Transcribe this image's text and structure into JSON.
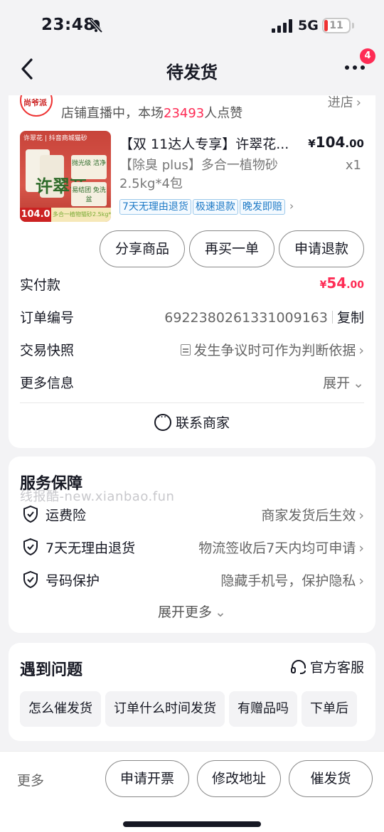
{
  "status_bar": {
    "time": "23:48",
    "network": "5G",
    "battery": "11"
  },
  "nav": {
    "title": "待发货",
    "badge": "4"
  },
  "shop": {
    "live_text": "店铺直播中，本场",
    "likes": "23493",
    "likes_suffix": "人点赞",
    "enter": "进店",
    "logo_text": "尚爷派"
  },
  "product": {
    "title": "【双 11达人专享】许翠花...",
    "price_symbol": "¥",
    "price_int": "104",
    "price_dec": ".00",
    "spec": "【除臭 plus】多合一植物砂 2.5kg*4包",
    "qty": "x1",
    "tags": [
      "7天无理由退货",
      "极速退款",
      "晚发即赔"
    ],
    "image": {
      "brand": "许翠花 | 抖音商城猫砂",
      "big_text": "许翠花",
      "tag1": "抛光级 洁净",
      "tag2": "易结团 免洗盆",
      "price_badge": "104.0",
      "strip": "多合一植物猫砂2.5kg*4"
    }
  },
  "actions": [
    "分享商品",
    "再买一单",
    "申请退款"
  ],
  "order": {
    "paid_label": "实付款",
    "paid_symbol": "¥",
    "paid_int": "54",
    "paid_dec": ".00",
    "number_label": "订单编号",
    "number": "6922380261331009163",
    "copy": "复制",
    "snapshot_label": "交易快照",
    "snapshot_value": "发生争议时可作为判断依据",
    "more_label": "更多信息",
    "more_value": "展开"
  },
  "contact": "联系商家",
  "service": {
    "title": "服务保障",
    "watermark": "线报酷-new.xianbao.fun",
    "items": [
      {
        "name": "运费险",
        "desc": "商家发货后生效"
      },
      {
        "name": "7天无理由退货",
        "desc": "物流签收后7天内均可申请"
      },
      {
        "name": "号码保护",
        "desc": "隐藏手机号，保护隐私"
      }
    ],
    "expand": "展开更多"
  },
  "problems": {
    "title": "遇到问题",
    "official": "官方客服",
    "chips": [
      "怎么催发货",
      "订单什么时间发货",
      "有赠品吗",
      "下单后"
    ]
  },
  "bottom": {
    "more": "更多",
    "buttons": [
      "申请开票",
      "修改地址",
      "催发货"
    ]
  },
  "colors": {
    "accent": "#fe2c55",
    "tag_blue": "#1d79c6"
  }
}
